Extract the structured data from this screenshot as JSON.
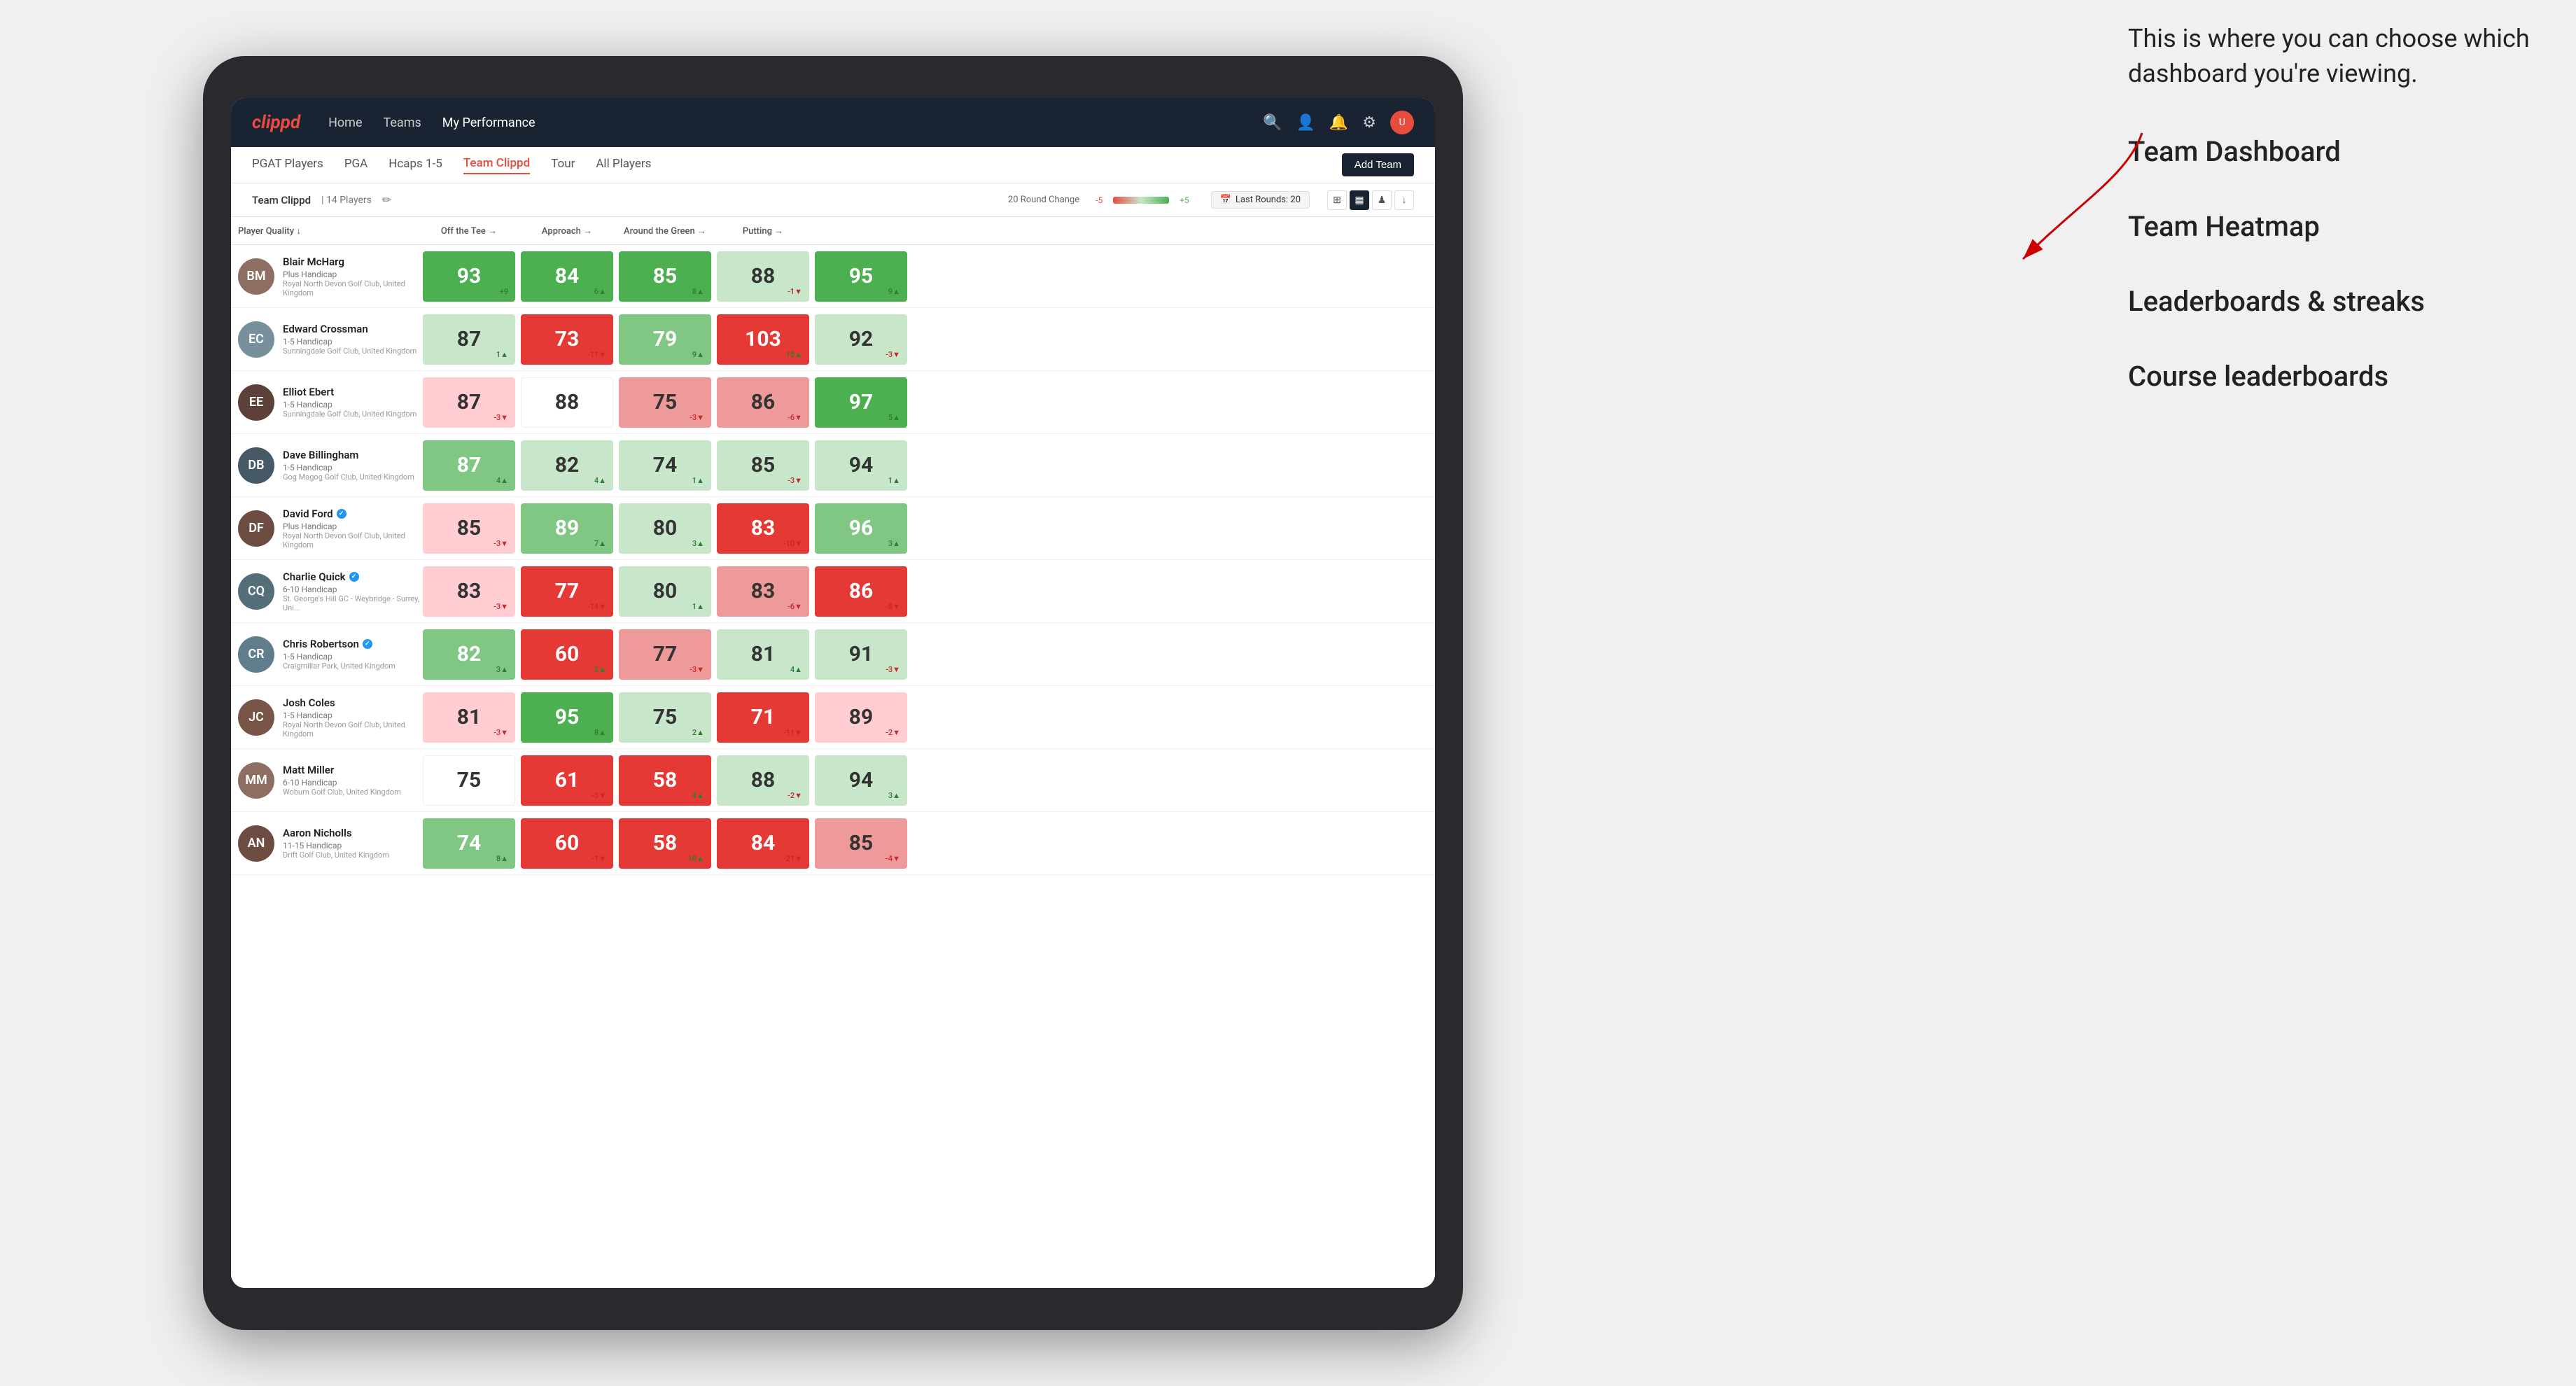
{
  "annotation": {
    "intro_text": "This is where you can choose which dashboard you're viewing.",
    "menu_items": [
      "Team Dashboard",
      "Team Heatmap",
      "Leaderboards & streaks",
      "Course leaderboards"
    ]
  },
  "nav": {
    "logo": "clippd",
    "items": [
      "Home",
      "Teams",
      "My Performance"
    ],
    "active_item": "My Performance"
  },
  "sub_nav": {
    "items": [
      "PGAT Players",
      "PGA",
      "Hcaps 1-5",
      "Team Clippd",
      "Tour",
      "All Players"
    ],
    "active_item": "Team Clippd",
    "add_team_label": "Add Team"
  },
  "team_bar": {
    "team_name": "Team Clippd",
    "separator": "|",
    "player_count": "14 Players",
    "round_change_label": "20 Round Change",
    "neg_label": "-5",
    "pos_label": "+5",
    "last_rounds_label": "Last Rounds:",
    "last_rounds_value": "20"
  },
  "table": {
    "headers": [
      "Player Quality ↓",
      "Off the Tee →",
      "Approach →",
      "Around the Green →",
      "Putting →"
    ],
    "players": [
      {
        "name": "Blair McHarg",
        "handicap": "Plus Handicap",
        "club": "Royal North Devon Golf Club, United Kingdom",
        "avatar_color": "#8d6e63",
        "initials": "BM",
        "scores": [
          {
            "value": 93,
            "change": "+9",
            "dir": "up",
            "color": "bg-green-dark"
          },
          {
            "value": 84,
            "change": "6▲",
            "dir": "up",
            "color": "bg-green-dark"
          },
          {
            "value": 85,
            "change": "8▲",
            "dir": "up",
            "color": "bg-green-dark"
          },
          {
            "value": 88,
            "change": "-1▼",
            "dir": "down",
            "color": "bg-green-light"
          },
          {
            "value": 95,
            "change": "9▲",
            "dir": "up",
            "color": "bg-green-dark"
          }
        ]
      },
      {
        "name": "Edward Crossman",
        "handicap": "1-5 Handicap",
        "club": "Sunningdale Golf Club, United Kingdom",
        "avatar_color": "#78909c",
        "initials": "EC",
        "scores": [
          {
            "value": 87,
            "change": "1▲",
            "dir": "up",
            "color": "bg-green-light"
          },
          {
            "value": 73,
            "change": "-11▼",
            "dir": "down",
            "color": "bg-red-dark"
          },
          {
            "value": 79,
            "change": "9▲",
            "dir": "up",
            "color": "bg-green-med"
          },
          {
            "value": 103,
            "change": "15▲",
            "dir": "up",
            "color": "bg-red-dark"
          },
          {
            "value": 92,
            "change": "-3▼",
            "dir": "down",
            "color": "bg-green-light"
          }
        ]
      },
      {
        "name": "Elliot Ebert",
        "handicap": "1-5 Handicap",
        "club": "Sunningdale Golf Club, United Kingdom",
        "avatar_color": "#5d4037",
        "initials": "EE",
        "scores": [
          {
            "value": 87,
            "change": "-3▼",
            "dir": "down",
            "color": "bg-red-light"
          },
          {
            "value": 88,
            "change": "",
            "dir": "",
            "color": "bg-white"
          },
          {
            "value": 75,
            "change": "-3▼",
            "dir": "down",
            "color": "bg-red-med"
          },
          {
            "value": 86,
            "change": "-6▼",
            "dir": "down",
            "color": "bg-red-med"
          },
          {
            "value": 97,
            "change": "5▲",
            "dir": "up",
            "color": "bg-green-dark"
          }
        ]
      },
      {
        "name": "Dave Billingham",
        "handicap": "1-5 Handicap",
        "club": "Gog Magog Golf Club, United Kingdom",
        "avatar_color": "#455a64",
        "initials": "DB",
        "scores": [
          {
            "value": 87,
            "change": "4▲",
            "dir": "up",
            "color": "bg-green-med"
          },
          {
            "value": 82,
            "change": "4▲",
            "dir": "up",
            "color": "bg-green-light"
          },
          {
            "value": 74,
            "change": "1▲",
            "dir": "up",
            "color": "bg-green-light"
          },
          {
            "value": 85,
            "change": "-3▼",
            "dir": "down",
            "color": "bg-green-light"
          },
          {
            "value": 94,
            "change": "1▲",
            "dir": "up",
            "color": "bg-green-light"
          }
        ]
      },
      {
        "name": "David Ford",
        "handicap": "Plus Handicap",
        "club": "Royal North Devon Golf Club, United Kingdom",
        "avatar_color": "#6d4c41",
        "initials": "DF",
        "verified": true,
        "scores": [
          {
            "value": 85,
            "change": "-3▼",
            "dir": "down",
            "color": "bg-red-light"
          },
          {
            "value": 89,
            "change": "7▲",
            "dir": "up",
            "color": "bg-green-med"
          },
          {
            "value": 80,
            "change": "3▲",
            "dir": "up",
            "color": "bg-green-light"
          },
          {
            "value": 83,
            "change": "-10▼",
            "dir": "down",
            "color": "bg-red-dark"
          },
          {
            "value": 96,
            "change": "3▲",
            "dir": "up",
            "color": "bg-green-med"
          }
        ]
      },
      {
        "name": "Charlie Quick",
        "handicap": "6-10 Handicap",
        "club": "St. George's Hill GC - Weybridge - Surrey, Uni...",
        "avatar_color": "#546e7a",
        "initials": "CQ",
        "verified": true,
        "scores": [
          {
            "value": 83,
            "change": "-3▼",
            "dir": "down",
            "color": "bg-red-light"
          },
          {
            "value": 77,
            "change": "-14▼",
            "dir": "down",
            "color": "bg-red-dark"
          },
          {
            "value": 80,
            "change": "1▲",
            "dir": "up",
            "color": "bg-green-light"
          },
          {
            "value": 83,
            "change": "-6▼",
            "dir": "down",
            "color": "bg-red-med"
          },
          {
            "value": 86,
            "change": "-8▼",
            "dir": "down",
            "color": "bg-red-dark"
          }
        ]
      },
      {
        "name": "Chris Robertson",
        "handicap": "1-5 Handicap",
        "club": "Craigmillar Park, United Kingdom",
        "avatar_color": "#607d8b",
        "initials": "CR",
        "verified": true,
        "scores": [
          {
            "value": 82,
            "change": "3▲",
            "dir": "up",
            "color": "bg-green-med"
          },
          {
            "value": 60,
            "change": "2▲",
            "dir": "up",
            "color": "bg-red-dark"
          },
          {
            "value": 77,
            "change": "-3▼",
            "dir": "down",
            "color": "bg-red-med"
          },
          {
            "value": 81,
            "change": "4▲",
            "dir": "up",
            "color": "bg-green-light"
          },
          {
            "value": 91,
            "change": "-3▼",
            "dir": "down",
            "color": "bg-green-light"
          }
        ]
      },
      {
        "name": "Josh Coles",
        "handicap": "1-5 Handicap",
        "club": "Royal North Devon Golf Club, United Kingdom",
        "avatar_color": "#795548",
        "initials": "JC",
        "scores": [
          {
            "value": 81,
            "change": "-3▼",
            "dir": "down",
            "color": "bg-red-light"
          },
          {
            "value": 95,
            "change": "8▲",
            "dir": "up",
            "color": "bg-green-dark"
          },
          {
            "value": 75,
            "change": "2▲",
            "dir": "up",
            "color": "bg-green-light"
          },
          {
            "value": 71,
            "change": "-11▼",
            "dir": "down",
            "color": "bg-red-dark"
          },
          {
            "value": 89,
            "change": "-2▼",
            "dir": "down",
            "color": "bg-red-light"
          }
        ]
      },
      {
        "name": "Matt Miller",
        "handicap": "6-10 Handicap",
        "club": "Woburn Golf Club, United Kingdom",
        "avatar_color": "#8d6e63",
        "initials": "MM",
        "scores": [
          {
            "value": 75,
            "change": "",
            "dir": "",
            "color": "bg-white"
          },
          {
            "value": 61,
            "change": "-3▼",
            "dir": "down",
            "color": "bg-red-dark"
          },
          {
            "value": 58,
            "change": "4▲",
            "dir": "up",
            "color": "bg-red-dark"
          },
          {
            "value": 88,
            "change": "-2▼",
            "dir": "down",
            "color": "bg-green-light"
          },
          {
            "value": 94,
            "change": "3▲",
            "dir": "up",
            "color": "bg-green-light"
          }
        ]
      },
      {
        "name": "Aaron Nicholls",
        "handicap": "11-15 Handicap",
        "club": "Drift Golf Club, United Kingdom",
        "avatar_color": "#6d4c41",
        "initials": "AN",
        "scores": [
          {
            "value": 74,
            "change": "8▲",
            "dir": "up",
            "color": "bg-green-med"
          },
          {
            "value": 60,
            "change": "-1▼",
            "dir": "down",
            "color": "bg-red-dark"
          },
          {
            "value": 58,
            "change": "10▲",
            "dir": "up",
            "color": "bg-red-dark"
          },
          {
            "value": 84,
            "change": "-21▼",
            "dir": "down",
            "color": "bg-red-dark"
          },
          {
            "value": 85,
            "change": "-4▼",
            "dir": "down",
            "color": "bg-red-med"
          }
        ]
      }
    ]
  }
}
